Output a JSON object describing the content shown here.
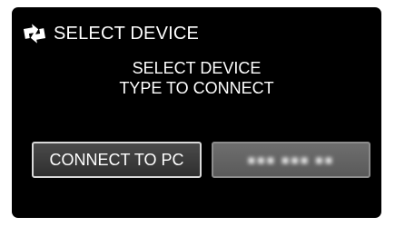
{
  "header": {
    "icon": "usb-connect-icon",
    "title": "SELECT DEVICE"
  },
  "message": {
    "line1": "SELECT DEVICE",
    "line2": "TYPE TO CONNECT"
  },
  "buttons": {
    "connect_pc_label": "CONNECT TO PC",
    "other_device_label": "■■■ ■■■ ■■"
  },
  "colors": {
    "background": "#000000",
    "text": "#ffffff",
    "selected_border": "#d8d8d8",
    "unselected_button": "#666666"
  }
}
